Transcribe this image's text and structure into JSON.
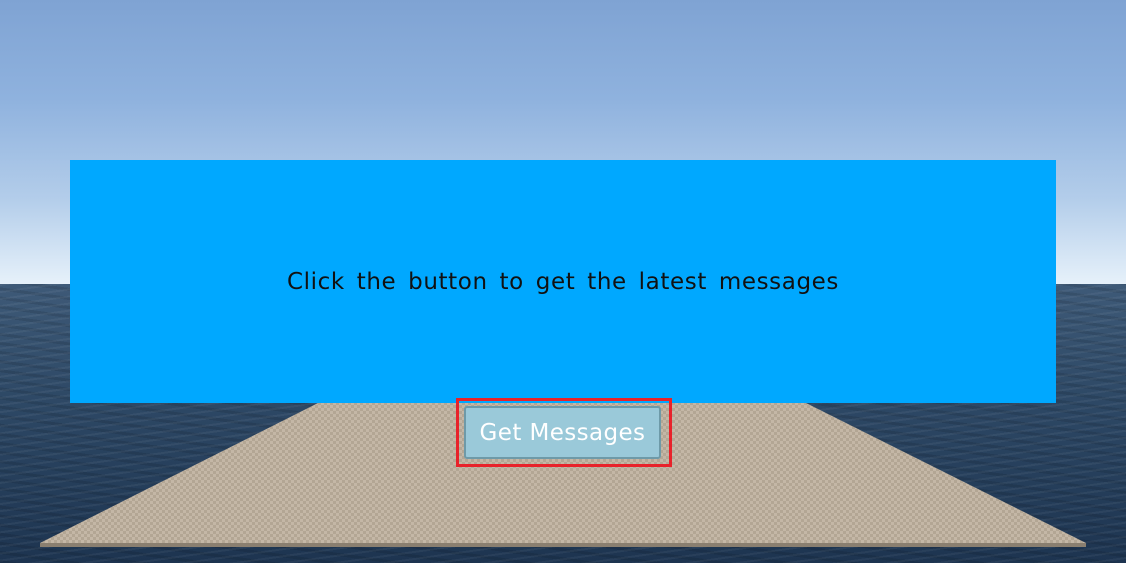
{
  "panel": {
    "message": "Click the button to get the latest messages",
    "background_color": "#00a8ff"
  },
  "button": {
    "label": "Get Messages",
    "background_color": "#9ac9d9",
    "text_color": "#ffffff"
  },
  "highlight": {
    "color": "#e8222a"
  },
  "scene": {
    "sky_color": "#8fb2de",
    "sea_color": "#2e4966",
    "baseplate_color": "#c2b5a4"
  }
}
